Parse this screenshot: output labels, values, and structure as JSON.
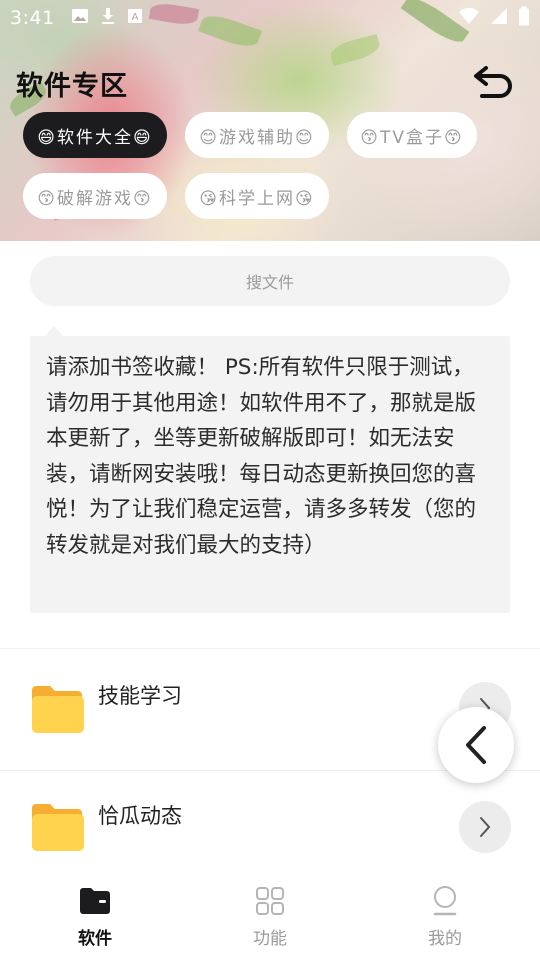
{
  "status_bar": {
    "time": "3:41",
    "icons_left": [
      "image-icon",
      "download-icon",
      "font-app-icon"
    ],
    "icons_right": [
      "wifi-icon",
      "signal-icon",
      "battery-icon"
    ]
  },
  "header": {
    "title": "软件专区",
    "back_icon": "undo-arrow-icon",
    "chips": [
      {
        "label": "😄软件大全😄",
        "active": true
      },
      {
        "label": "😊游戏辅助😊",
        "active": false
      },
      {
        "label": "😙TV盒子😙",
        "active": false
      },
      {
        "label": "😙破解游戏😙",
        "active": false
      },
      {
        "label": "😘科学上网😘",
        "active": false
      }
    ]
  },
  "search": {
    "placeholder": "搜文件"
  },
  "notice": {
    "text": "请添加书签收藏！ PS:所有软件只限于测试，请勿用于其他用途！如软件用不了，那就是版本更新了，坐等更新破解版即可！如无法安装，请断网安装哦！每日动态更新换回您的喜悦！为了让我们稳定运营，请多多转发（您的转发就是对我们最大的支持）"
  },
  "folders": [
    {
      "title": "技能学习",
      "icon": "folder-icon"
    },
    {
      "title": "恰瓜动态",
      "icon": "folder-icon"
    }
  ],
  "float_button": {
    "icon": "chevron-left-icon"
  },
  "bottom_nav": [
    {
      "label": "软件",
      "icon": "folder-tab-icon",
      "active": true
    },
    {
      "label": "功能",
      "icon": "grid-icon",
      "active": false
    },
    {
      "label": "我的",
      "icon": "user-icon",
      "active": false
    }
  ],
  "colors": {
    "accent_dark": "#1c1c1e",
    "folder_yellow": "#ffd34e",
    "folder_orange": "#f6ae32",
    "surface_gray": "#f3f3f3",
    "text_muted": "#9a9a9a"
  }
}
